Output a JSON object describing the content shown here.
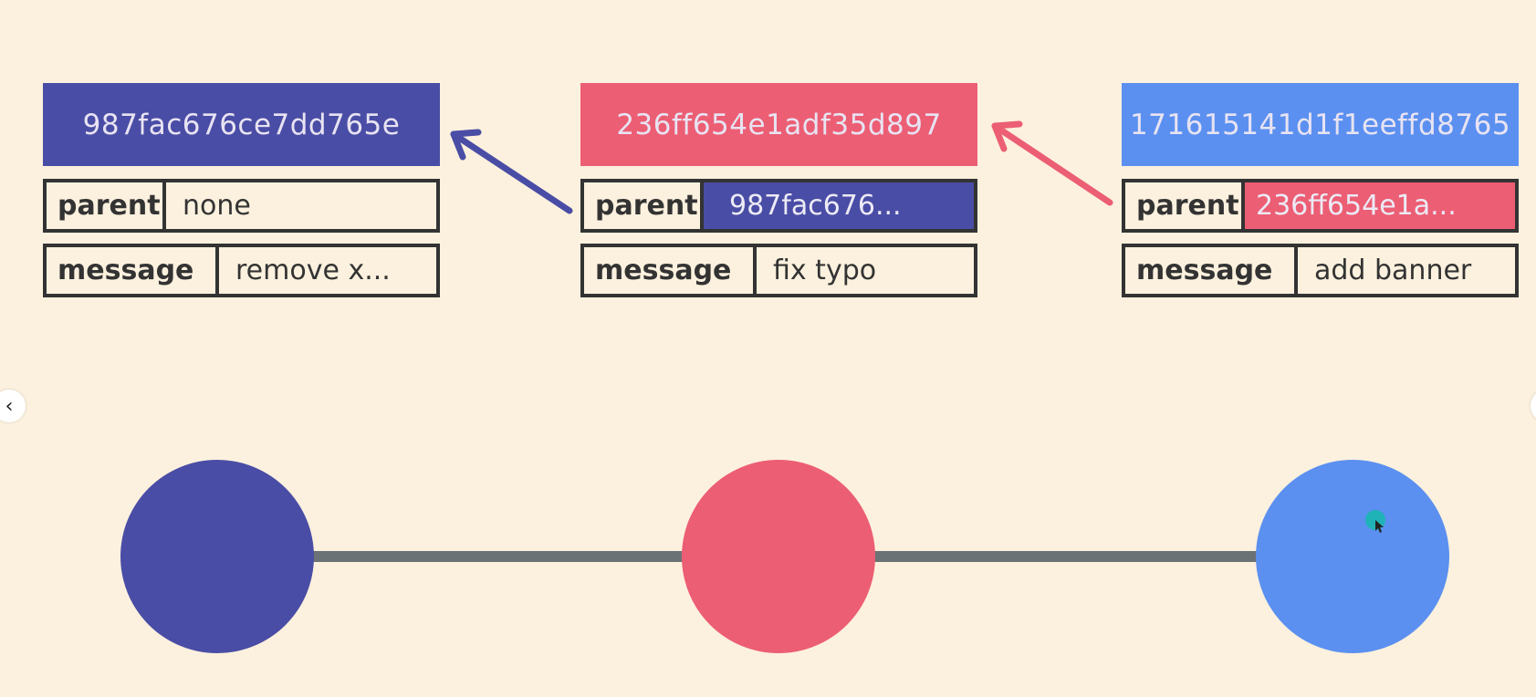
{
  "colors": {
    "background": "#fcf1de",
    "navy": "#4a4da5",
    "pink": "#ec5e74",
    "blue": "#5b90f0",
    "line": "#6b7275",
    "border": "#333333",
    "cursor": "#1fb3b8"
  },
  "commits": [
    {
      "hash": "987fac676ce7dd765e",
      "parent_label": "parent",
      "parent": "none",
      "message_label": "message",
      "message": "remove x..."
    },
    {
      "hash": "236ff654e1adf35d897",
      "parent_label": "parent",
      "parent": "987fac676...",
      "message_label": "message",
      "message": "fix typo"
    },
    {
      "hash": "171615141d1f1eeffd8765",
      "parent_label": "parent",
      "parent": "236ff654e1a...",
      "message_label": "message",
      "message": "add banner"
    }
  ],
  "nav": {
    "prev_icon": "chevron-left-icon",
    "prev_glyph": "‹",
    "next_icon": "chevron-right-icon"
  }
}
